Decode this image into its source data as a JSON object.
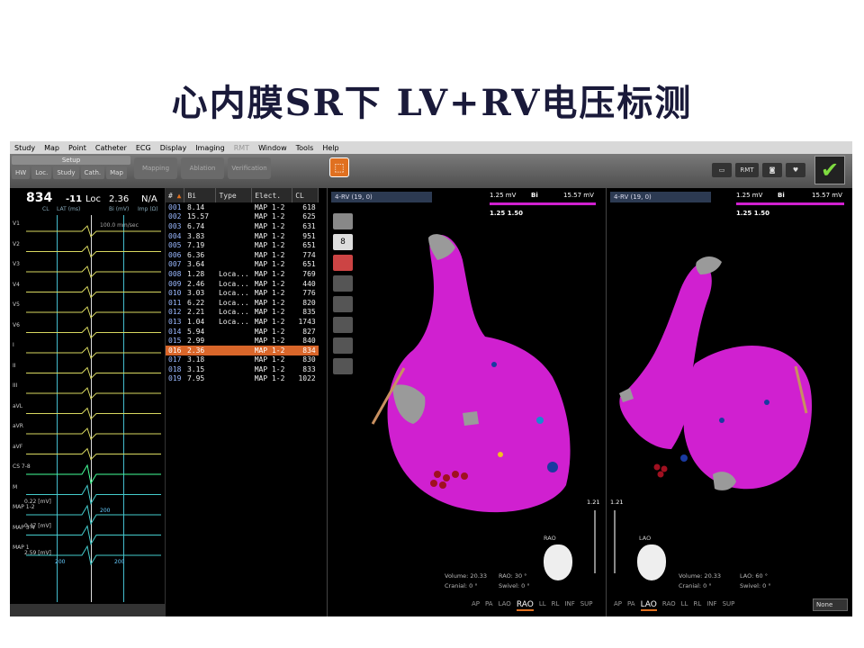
{
  "slide": {
    "title": "心内膜SR下 LV+RV电压标测"
  },
  "menu": [
    "Study",
    "Map",
    "Point",
    "Catheter",
    "ECG",
    "Display",
    "Imaging",
    "RMT",
    "Window",
    "Tools",
    "Help"
  ],
  "toolbar": {
    "setup": "Setup",
    "subtabs": [
      "HW",
      "Loc.",
      "Study",
      "Cath.",
      "Map"
    ],
    "modes": [
      "Mapping",
      "Ablation",
      "Verification"
    ],
    "rmt": "RMT"
  },
  "ecg": {
    "value": "834",
    "value_label": "CL",
    "lat": "-11",
    "lat_label": "LAT (ms)",
    "loc": "Loc",
    "bi": "2.36",
    "bi_label": "Bi (mV)",
    "imp": "N/A",
    "imp_label": "Imp (Ω)",
    "speed": "100.0 mm/sec",
    "leads": [
      "V1",
      "V2",
      "V3",
      "V4",
      "V5",
      "V6",
      "I",
      "II",
      "III",
      "aVL",
      "aVR",
      "aVF",
      "CS 7-8",
      "M",
      "MAP 1-2",
      "MAP 3-4",
      "MAP 1"
    ],
    "scale_texts": [
      "0.22 [mV]",
      "0.47 [mV]",
      "2.59 [mV]"
    ],
    "markers": [
      "200",
      "200",
      "200"
    ]
  },
  "table": {
    "headers": [
      "#",
      "Bi",
      "Type",
      "Elect.",
      "CL"
    ],
    "rows": [
      [
        "001",
        "8.14",
        "",
        "MAP 1-2",
        "618"
      ],
      [
        "002",
        "15.57",
        "",
        "MAP 1-2",
        "625"
      ],
      [
        "003",
        "6.74",
        "",
        "MAP 1-2",
        "631"
      ],
      [
        "004",
        "3.83",
        "",
        "MAP 1-2",
        "951"
      ],
      [
        "005",
        "7.19",
        "",
        "MAP 1-2",
        "651"
      ],
      [
        "006",
        "6.36",
        "",
        "MAP 1-2",
        "774"
      ],
      [
        "007",
        "3.64",
        "",
        "MAP 1-2",
        "651"
      ],
      [
        "008",
        "1.28",
        "Loca...",
        "MAP 1-2",
        "769"
      ],
      [
        "009",
        "2.46",
        "Loca...",
        "MAP 1-2",
        "440"
      ],
      [
        "010",
        "3.03",
        "Loca...",
        "MAP 1-2",
        "776"
      ],
      [
        "011",
        "6.22",
        "Loca...",
        "MAP 1-2",
        "820"
      ],
      [
        "012",
        "2.21",
        "Loca...",
        "MAP 1-2",
        "835"
      ],
      [
        "013",
        "1.04",
        "Loca...",
        "MAP 1-2",
        "1743"
      ],
      [
        "014",
        "5.94",
        "",
        "MAP 1-2",
        "827"
      ],
      [
        "015",
        "2.99",
        "",
        "MAP 1-2",
        "840"
      ],
      [
        "016",
        "2.36",
        "",
        "MAP 1-2",
        "834"
      ],
      [
        "017",
        "3.18",
        "",
        "MAP 1-2",
        "830"
      ],
      [
        "018",
        "3.15",
        "",
        "MAP 1-2",
        "833"
      ],
      [
        "019",
        "7.95",
        "",
        "MAP 1-2",
        "1022"
      ]
    ],
    "selected_index": 15
  },
  "map1": {
    "map_select": "4-RV (19, 0)",
    "scale_low": "1.25 mV",
    "scale_mid": "Bi",
    "scale_high": "15.57 mV",
    "scale_vals": "1.25  1.50",
    "spinner": "8",
    "slider_val": "1.21",
    "heart_view": "RAO",
    "volume": "Volume: 20.33",
    "cranial": "Cranial:   0 °",
    "angle": "RAO:   30 °",
    "swivel": "Swivel:   0 °",
    "views": [
      "AP",
      "PA",
      "LAO",
      "RAO",
      "LL",
      "RL",
      "INF",
      "SUP"
    ],
    "active_view": "RAO"
  },
  "map2": {
    "map_select": "4-RV (19, 0)",
    "scale_low": "1.25 mV",
    "scale_mid": "Bi",
    "scale_high": "15.57 mV",
    "scale_vals": "1.25  1.50",
    "slider_val": "1.21",
    "heart_view": "LAO",
    "volume": "Volume: 20.33",
    "cranial": "Cranial:   0 °",
    "angle": "LAO:   60 °",
    "swivel": "Swivel:   0 °",
    "views": [
      "AP",
      "PA",
      "LAO",
      "RAO",
      "LL",
      "RL",
      "INF",
      "SUP"
    ],
    "active_view": "LAO",
    "none_select": "None"
  },
  "colors": {
    "magenta": "#d020d0",
    "gray": "#9a9a9a",
    "accent": "#d9662a"
  }
}
